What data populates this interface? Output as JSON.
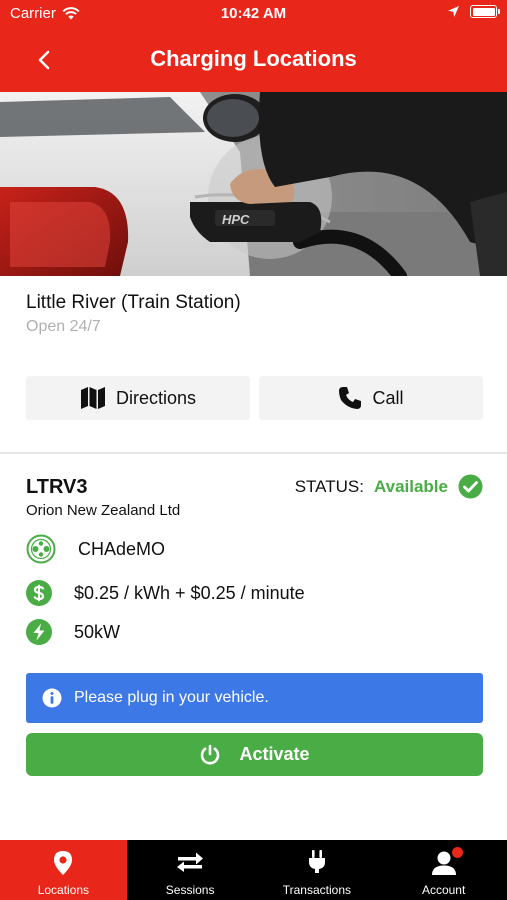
{
  "status_bar": {
    "carrier": "Carrier",
    "time": "10:42 AM",
    "icons": [
      "wifi-icon",
      "location-arrow-icon",
      "battery-icon"
    ]
  },
  "header": {
    "title": "Charging Locations",
    "back_icon": "chevron-left-icon"
  },
  "colors": {
    "brand_red": "#e8261a",
    "success_green": "#4aac45",
    "info_blue": "#3c78e6",
    "muted_text": "#b0b0b0"
  },
  "location": {
    "name": "Little River (Train Station)",
    "hours": "Open 24/7",
    "hero_image": "ev-charger-plugged-into-car-photo",
    "hero_badge_text": "HPC"
  },
  "actions": {
    "directions": {
      "label": "Directions",
      "icon": "map-icon"
    },
    "call": {
      "label": "Call",
      "icon": "phone-icon"
    }
  },
  "station": {
    "id": "LTRV3",
    "operator": "Orion New Zealand Ltd",
    "status_label": "STATUS:",
    "status_value": "Available",
    "status_icon": "check-circle-icon",
    "connector": {
      "label": "CHAdeMO",
      "icon": "chademo-connector-icon"
    },
    "price": {
      "label": "$0.25 / kWh + $0.25 / minute",
      "icon": "dollar-icon"
    },
    "power": {
      "label": "50kW",
      "icon": "lightning-icon"
    }
  },
  "info_banner": {
    "text": "Please plug in your vehicle.",
    "icon": "info-icon"
  },
  "activate": {
    "label": "Activate",
    "icon": "power-icon"
  },
  "tabs": [
    {
      "label": "Locations",
      "icon": "map-pin-icon",
      "active": true
    },
    {
      "label": "Sessions",
      "icon": "swap-arrows-icon",
      "active": false
    },
    {
      "label": "Transactions",
      "icon": "plug-icon",
      "active": false
    },
    {
      "label": "Account",
      "icon": "user-icon",
      "active": false,
      "has_notification": true
    }
  ]
}
